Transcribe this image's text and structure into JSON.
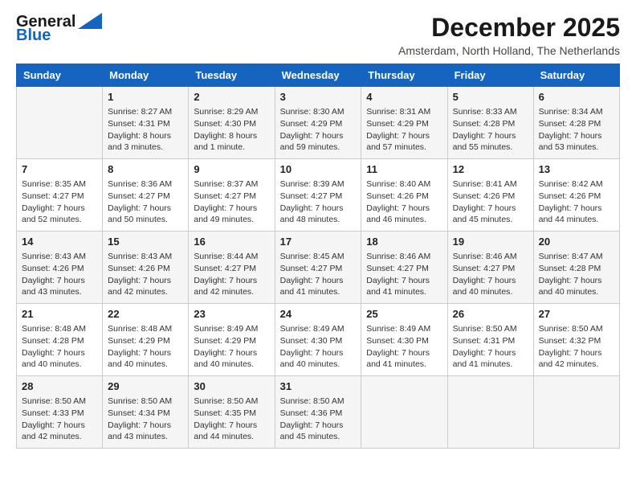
{
  "header": {
    "logo_line1": "General",
    "logo_line2": "Blue",
    "month": "December 2025",
    "location": "Amsterdam, North Holland, The Netherlands"
  },
  "weekdays": [
    "Sunday",
    "Monday",
    "Tuesday",
    "Wednesday",
    "Thursday",
    "Friday",
    "Saturday"
  ],
  "weeks": [
    [
      {
        "day": "",
        "content": ""
      },
      {
        "day": "1",
        "content": "Sunrise: 8:27 AM\nSunset: 4:31 PM\nDaylight: 8 hours\nand 3 minutes."
      },
      {
        "day": "2",
        "content": "Sunrise: 8:29 AM\nSunset: 4:30 PM\nDaylight: 8 hours\nand 1 minute."
      },
      {
        "day": "3",
        "content": "Sunrise: 8:30 AM\nSunset: 4:29 PM\nDaylight: 7 hours\nand 59 minutes."
      },
      {
        "day": "4",
        "content": "Sunrise: 8:31 AM\nSunset: 4:29 PM\nDaylight: 7 hours\nand 57 minutes."
      },
      {
        "day": "5",
        "content": "Sunrise: 8:33 AM\nSunset: 4:28 PM\nDaylight: 7 hours\nand 55 minutes."
      },
      {
        "day": "6",
        "content": "Sunrise: 8:34 AM\nSunset: 4:28 PM\nDaylight: 7 hours\nand 53 minutes."
      }
    ],
    [
      {
        "day": "7",
        "content": "Sunrise: 8:35 AM\nSunset: 4:27 PM\nDaylight: 7 hours\nand 52 minutes."
      },
      {
        "day": "8",
        "content": "Sunrise: 8:36 AM\nSunset: 4:27 PM\nDaylight: 7 hours\nand 50 minutes."
      },
      {
        "day": "9",
        "content": "Sunrise: 8:37 AM\nSunset: 4:27 PM\nDaylight: 7 hours\nand 49 minutes."
      },
      {
        "day": "10",
        "content": "Sunrise: 8:39 AM\nSunset: 4:27 PM\nDaylight: 7 hours\nand 48 minutes."
      },
      {
        "day": "11",
        "content": "Sunrise: 8:40 AM\nSunset: 4:26 PM\nDaylight: 7 hours\nand 46 minutes."
      },
      {
        "day": "12",
        "content": "Sunrise: 8:41 AM\nSunset: 4:26 PM\nDaylight: 7 hours\nand 45 minutes."
      },
      {
        "day": "13",
        "content": "Sunrise: 8:42 AM\nSunset: 4:26 PM\nDaylight: 7 hours\nand 44 minutes."
      }
    ],
    [
      {
        "day": "14",
        "content": "Sunrise: 8:43 AM\nSunset: 4:26 PM\nDaylight: 7 hours\nand 43 minutes."
      },
      {
        "day": "15",
        "content": "Sunrise: 8:43 AM\nSunset: 4:26 PM\nDaylight: 7 hours\nand 42 minutes."
      },
      {
        "day": "16",
        "content": "Sunrise: 8:44 AM\nSunset: 4:27 PM\nDaylight: 7 hours\nand 42 minutes."
      },
      {
        "day": "17",
        "content": "Sunrise: 8:45 AM\nSunset: 4:27 PM\nDaylight: 7 hours\nand 41 minutes."
      },
      {
        "day": "18",
        "content": "Sunrise: 8:46 AM\nSunset: 4:27 PM\nDaylight: 7 hours\nand 41 minutes."
      },
      {
        "day": "19",
        "content": "Sunrise: 8:46 AM\nSunset: 4:27 PM\nDaylight: 7 hours\nand 40 minutes."
      },
      {
        "day": "20",
        "content": "Sunrise: 8:47 AM\nSunset: 4:28 PM\nDaylight: 7 hours\nand 40 minutes."
      }
    ],
    [
      {
        "day": "21",
        "content": "Sunrise: 8:48 AM\nSunset: 4:28 PM\nDaylight: 7 hours\nand 40 minutes."
      },
      {
        "day": "22",
        "content": "Sunrise: 8:48 AM\nSunset: 4:29 PM\nDaylight: 7 hours\nand 40 minutes."
      },
      {
        "day": "23",
        "content": "Sunrise: 8:49 AM\nSunset: 4:29 PM\nDaylight: 7 hours\nand 40 minutes."
      },
      {
        "day": "24",
        "content": "Sunrise: 8:49 AM\nSunset: 4:30 PM\nDaylight: 7 hours\nand 40 minutes."
      },
      {
        "day": "25",
        "content": "Sunrise: 8:49 AM\nSunset: 4:30 PM\nDaylight: 7 hours\nand 41 minutes."
      },
      {
        "day": "26",
        "content": "Sunrise: 8:50 AM\nSunset: 4:31 PM\nDaylight: 7 hours\nand 41 minutes."
      },
      {
        "day": "27",
        "content": "Sunrise: 8:50 AM\nSunset: 4:32 PM\nDaylight: 7 hours\nand 42 minutes."
      }
    ],
    [
      {
        "day": "28",
        "content": "Sunrise: 8:50 AM\nSunset: 4:33 PM\nDaylight: 7 hours\nand 42 minutes."
      },
      {
        "day": "29",
        "content": "Sunrise: 8:50 AM\nSunset: 4:34 PM\nDaylight: 7 hours\nand 43 minutes."
      },
      {
        "day": "30",
        "content": "Sunrise: 8:50 AM\nSunset: 4:35 PM\nDaylight: 7 hours\nand 44 minutes."
      },
      {
        "day": "31",
        "content": "Sunrise: 8:50 AM\nSunset: 4:36 PM\nDaylight: 7 hours\nand 45 minutes."
      },
      {
        "day": "",
        "content": ""
      },
      {
        "day": "",
        "content": ""
      },
      {
        "day": "",
        "content": ""
      }
    ]
  ]
}
